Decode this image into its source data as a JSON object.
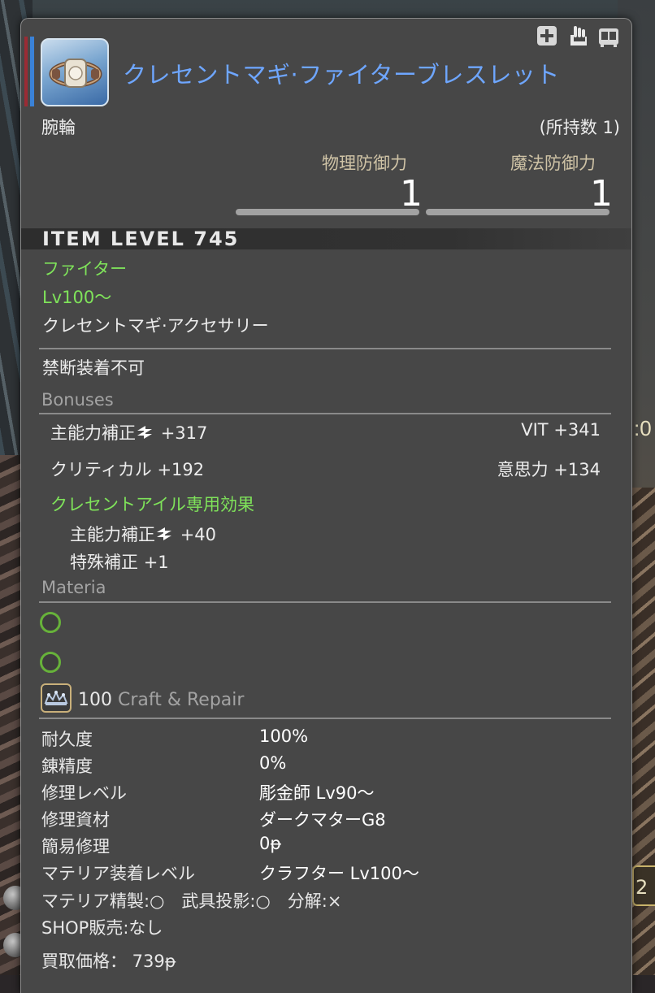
{
  "item": {
    "name": "クレセントマギ·ファイターブレスレット",
    "slot": "腕輪",
    "owned": "(所持数 1)",
    "icon": "bracelet-icon"
  },
  "defense": {
    "physical_label": "物理防御力",
    "physical_value": "1",
    "magic_label": "魔法防御力",
    "magic_value": "1"
  },
  "item_level": "ITEM LEVEL 745",
  "job": "ファイター",
  "level_req": "Lv100～",
  "category": "クレセントマギ·アクセサリー",
  "restriction": "禁断装着不可",
  "bonuses": {
    "header": "Bonuses",
    "left": [
      {
        "name": "主能力補正",
        "value": "+317",
        "icon": "double-arrow-icon"
      },
      {
        "name": "クリティカル",
        "value": "+192"
      }
    ],
    "right": [
      {
        "name": "VIT",
        "value": "+341"
      },
      {
        "name": "意思力",
        "value": "+134"
      }
    ],
    "special_header": "クレセントアイル専用効果",
    "special": [
      {
        "name": "主能力補正",
        "value": "+40",
        "icon": "double-arrow-icon"
      },
      {
        "name": "特殊補正",
        "value": "+1"
      }
    ]
  },
  "materia": {
    "header": "Materia",
    "slots": 2
  },
  "craft": {
    "level": "100",
    "header": "Craft & Repair",
    "rows": [
      {
        "label": "耐久度",
        "value": "100%"
      },
      {
        "label": "錬精度",
        "value": "0%"
      },
      {
        "label": "修理レベル",
        "value": "彫金師 Lv90～"
      },
      {
        "label": "修理資材",
        "value": "ダークマターG8"
      },
      {
        "label": "簡易修理",
        "value": "0ᵽ"
      },
      {
        "label": "マテリア装着レベル",
        "value": "クラフター Lv100～"
      }
    ],
    "flags_line": "マテリア精製:○　武具投影:○　分解:×",
    "shop": "SHOP販売:なし",
    "sell_price": "買取価格： 739ᵽ"
  },
  "background": {
    "right_number": ":0",
    "right_box": "2"
  },
  "colors": {
    "item_name": "#6ea6ff",
    "green": "#7fe35a",
    "panel": "#474747"
  }
}
